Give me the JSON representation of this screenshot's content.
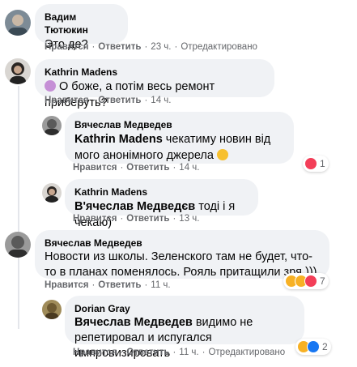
{
  "actions": {
    "like": "Нравится",
    "reply": "Ответить",
    "edited": "Отредактировано"
  },
  "comments": [
    {
      "author": "Вадим Тютюкин",
      "text": "Это де?",
      "time": "23 ч.",
      "edited": true
    },
    {
      "author": "Kathrin Madens",
      "text": "О боже, а потім весь ремонт приберуть?",
      "emoji": "woman-icon",
      "time": "14 ч.",
      "edited": false
    },
    {
      "author": "Вячеслав Медведев",
      "mention": "Kathrin Madens",
      "text": " чекатиму новин від мого анонімного джерела",
      "emoji": "smile-icon",
      "time": "14 ч.",
      "edited": false,
      "reactions": {
        "icons": [
          "love-reaction-icon"
        ],
        "count": "1"
      }
    },
    {
      "author": "Kathrin Madens",
      "mention": "В'ячеслав Медведєв",
      "text": " тоді і я чекаю)",
      "time": "13 ч.",
      "edited": false
    },
    {
      "author": "Вячеслав Медведев",
      "text": "Новости из школы. Зеленского там не будет, что-то в планах поменялось. Рояль притащили зря )))",
      "time": "11 ч.",
      "edited": false,
      "reactions": {
        "icons": [
          "laugh-reaction-icon",
          "sad-reaction-icon",
          "love-reaction-icon"
        ],
        "count": "7"
      }
    },
    {
      "author": "Dorian Gray",
      "mention": "Вячеслав Медведев",
      "text": " видимо не репетировал и испугался импровизировать",
      "time": "11 ч.",
      "edited": true,
      "reactions": {
        "icons": [
          "laugh-reaction-icon",
          "like-reaction-icon"
        ],
        "count": "2"
      }
    }
  ],
  "colors": {
    "bubble": "#f0f2f5",
    "meta_text": "#65676b",
    "love": "#f33e58",
    "like": "#1877f2",
    "haha": "#f7b125"
  }
}
